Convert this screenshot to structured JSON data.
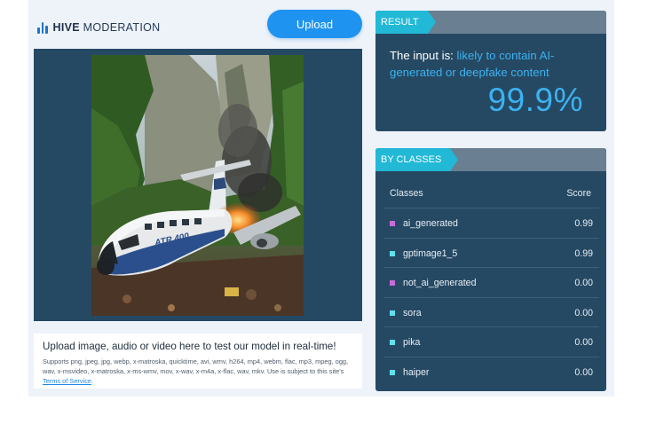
{
  "header": {
    "brand_bold": "HIVE",
    "brand_light": "MODERATION",
    "upload_label": "Upload"
  },
  "upload_info": {
    "title": "Upload image, audio or video here to test our model in real-time!",
    "description": "Supports png, jpeg, jpg, webp, x-matroska, quicktime, avi, wmv, h264, mp4, webm, flac, mp3, mpeg, ogg, wav, x-msvideo, x-matroska, x-ms-wmv, mov, x-wav, x-m4a, x-flac, wav, mkv. Use is subject to this site's",
    "tos_link": "Terms of Service",
    "tos_suffix": "."
  },
  "image": {
    "fuselage_text": "ATR 400"
  },
  "result": {
    "tag": "RESULT",
    "prefix": "The input is: ",
    "verdict": "likely to contain AI-generated or deepfake content",
    "score": "99.9%"
  },
  "classes": {
    "tag": "BY CLASSES",
    "col_class": "Classes",
    "col_score": "Score",
    "rows": [
      {
        "name": "ai_generated",
        "score": "0.99",
        "color": "#c86bd8"
      },
      {
        "name": "gptimage1_5",
        "score": "0.99",
        "color": "#5fe0ee"
      },
      {
        "name": "not_ai_generated",
        "score": "0.00",
        "color": "#c86bd8"
      },
      {
        "name": "sora",
        "score": "0.00",
        "color": "#5fe0ee"
      },
      {
        "name": "pika",
        "score": "0.00",
        "color": "#5fe0ee"
      },
      {
        "name": "haiper",
        "score": "0.00",
        "color": "#5fe0ee"
      }
    ]
  },
  "colors": {
    "accent": "#1e93f0",
    "card": "#264963",
    "tag": "#21b9d6",
    "highlight": "#3bb2f1"
  }
}
